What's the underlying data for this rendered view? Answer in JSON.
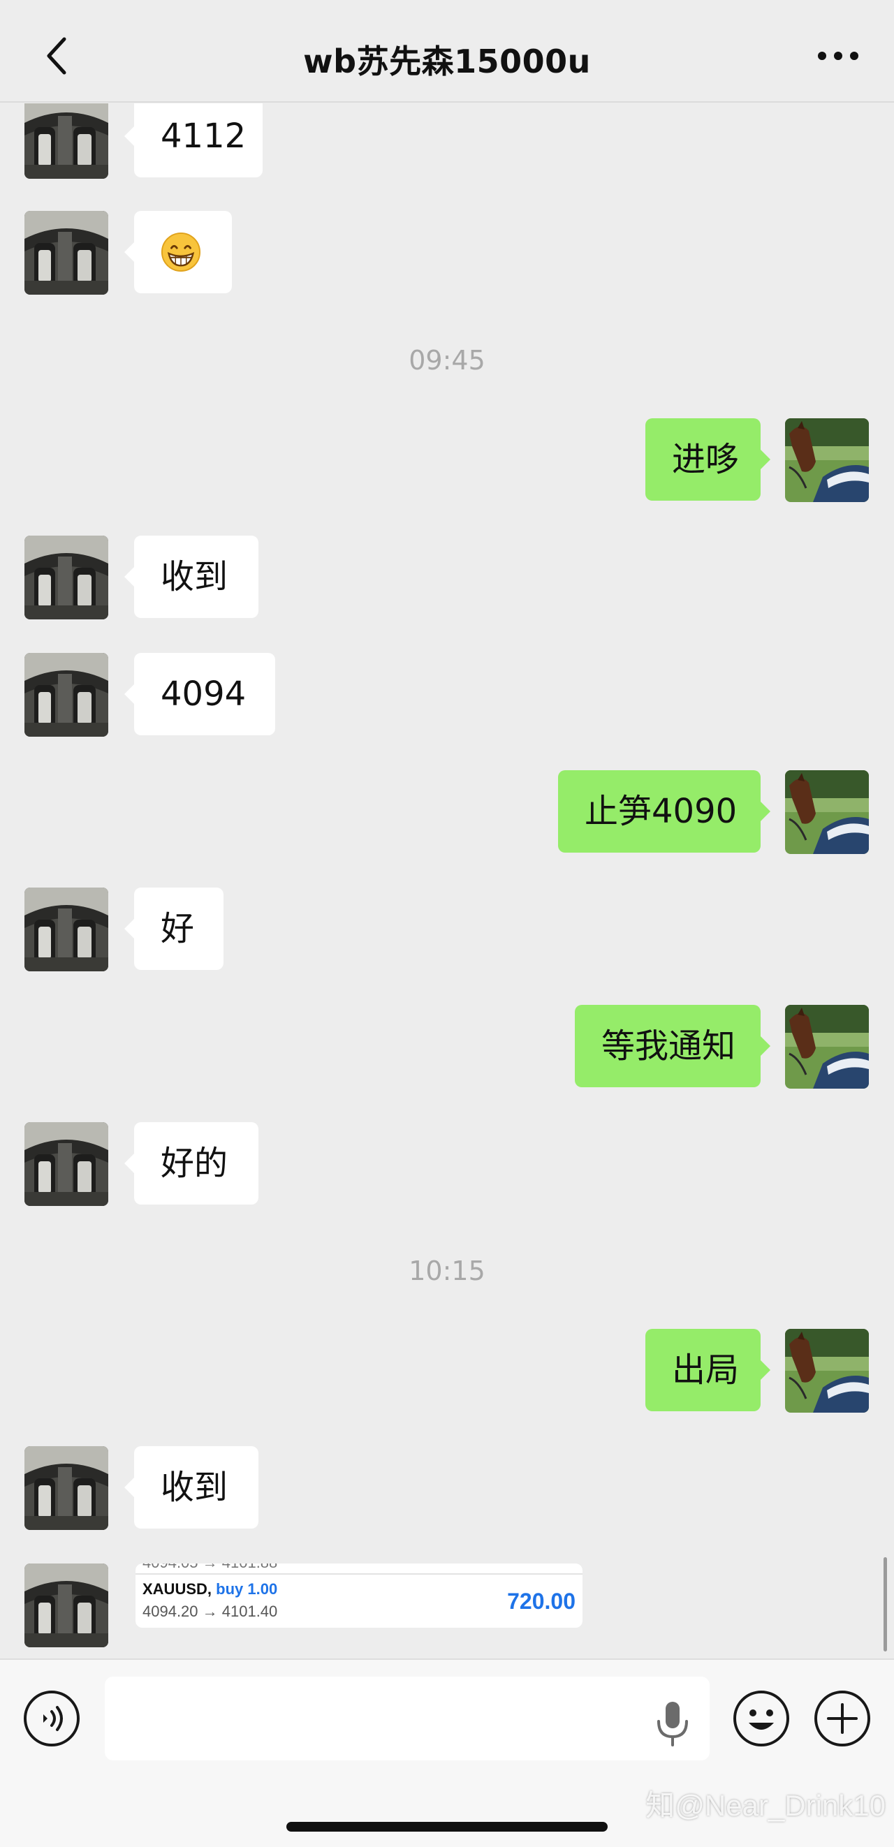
{
  "header": {
    "title": "wb苏先森15000u"
  },
  "messages": [
    {
      "side": "in",
      "text": "4112"
    },
    {
      "side": "in",
      "emoji": "grinning-face"
    },
    {
      "time": "09:45"
    },
    {
      "side": "out",
      "text": "进哆"
    },
    {
      "side": "in",
      "text": "收到"
    },
    {
      "side": "in",
      "text": "4094"
    },
    {
      "side": "out",
      "text": "止笋4090"
    },
    {
      "side": "in",
      "text": "好"
    },
    {
      "side": "out",
      "text": "等我通知"
    },
    {
      "side": "in",
      "text": "好的"
    },
    {
      "time": "10:15"
    },
    {
      "side": "out",
      "text": "出局"
    },
    {
      "side": "in",
      "text": "收到"
    }
  ],
  "trade": {
    "cut_line": "4094.05 → 4101.88",
    "symbol": "XAUUSD,",
    "side": "buy 1.00",
    "price": "4094.20 → 4101.40",
    "profit": "720.00"
  },
  "input": {
    "value": "",
    "placeholder": ""
  },
  "watermark": "知@Near_Drink10",
  "colors": {
    "background": "#ededed",
    "outgoing_bubble": "#95ec69",
    "incoming_bubble": "#ffffff",
    "timestamp": "#a8a8a8",
    "profit": "#1e73e8"
  }
}
